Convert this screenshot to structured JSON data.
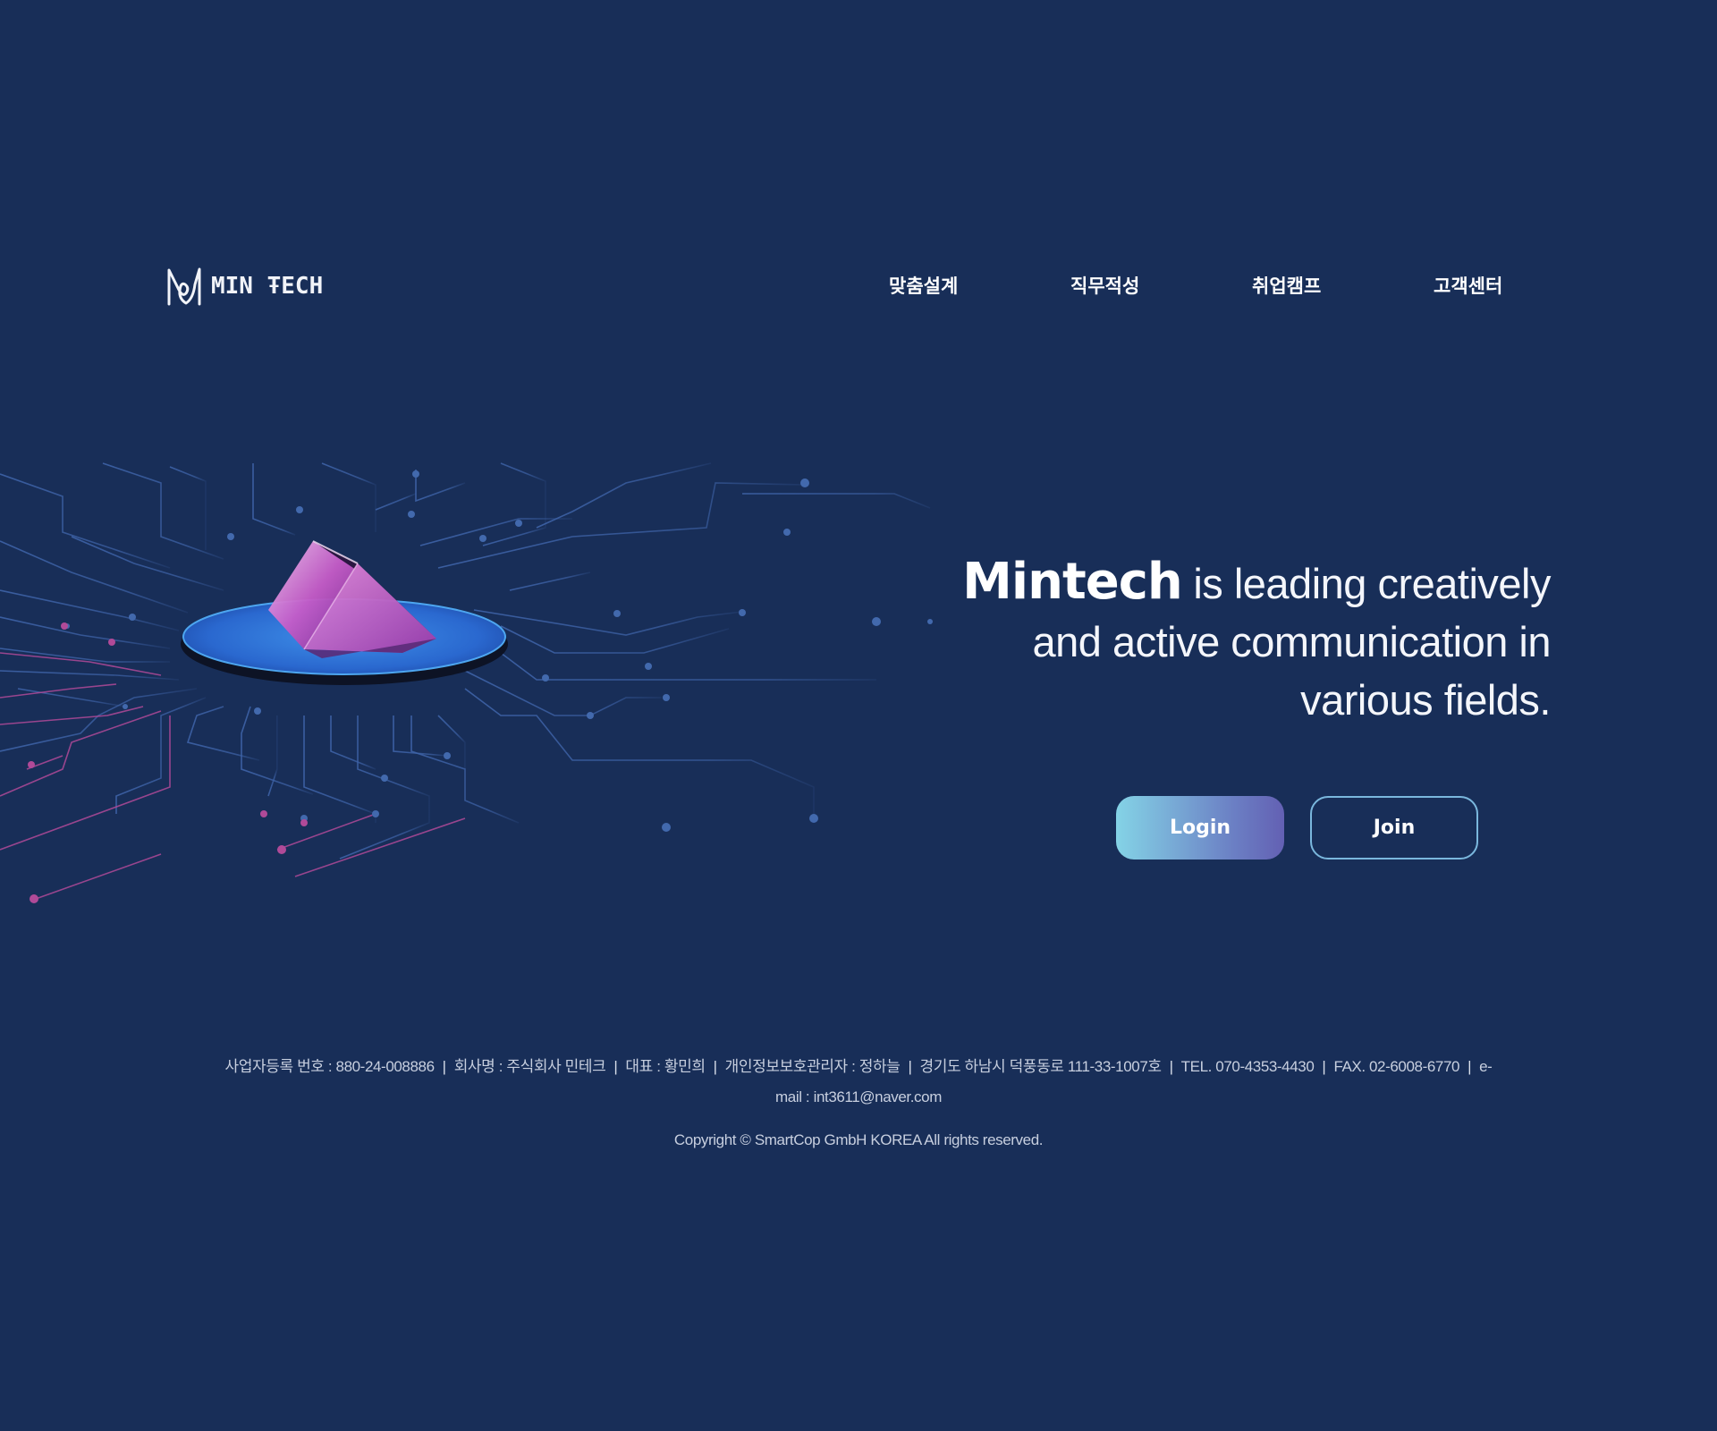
{
  "header": {
    "logo_text": "MIN ŦECH",
    "nav": [
      {
        "label": "맞춤설계"
      },
      {
        "label": "직무적성"
      },
      {
        "label": "취업캠프"
      },
      {
        "label": "고객센터"
      }
    ]
  },
  "hero": {
    "brand": "Mintech",
    "line1_rest": " is leading creatively",
    "line2": "and active communication in",
    "line3": "various fields.",
    "login_label": "Login",
    "join_label": "Join"
  },
  "footer": {
    "items": [
      "사업자등록 번호 : 880-24-008886",
      "회사명 : 주식회사 민테크",
      "대표 : 황민희",
      "개인정보보호관리자 : 정하늘",
      "경기도 하남시 덕풍동로 111-33-1007호",
      "TEL. 070-4353-4430",
      "FAX. 02-6008-6770",
      "e-mail : int3611@naver.com"
    ],
    "copyright": "Copyright © SmartCop GmbH KOREA All rights reserved."
  },
  "colors": {
    "background": "#182e58",
    "login_gradient_start": "#84d3e6",
    "login_gradient_end": "#6360b3",
    "join_border": "#7ab7dd",
    "circuit_blue": "#3e63a8",
    "circuit_pink": "#b04a98"
  },
  "icons": {
    "logo": "mintech-m-logo-icon",
    "hero_art": "circuit-board-prism-illustration"
  }
}
